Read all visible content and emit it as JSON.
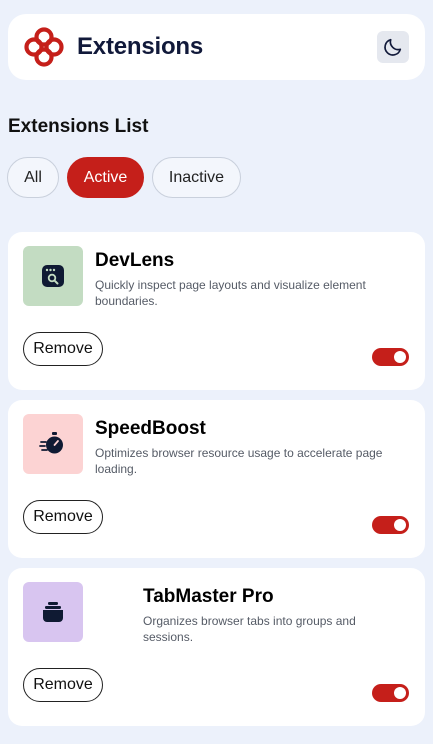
{
  "header": {
    "title": "Extensions",
    "logo_icon": "logo-icon",
    "theme_icon": "moon-icon"
  },
  "section": {
    "title": "Extensions List"
  },
  "filters": [
    {
      "label": "All",
      "selected": false
    },
    {
      "label": "Active",
      "selected": true
    },
    {
      "label": "Inactive",
      "selected": false
    }
  ],
  "extensions": [
    {
      "name": "DevLens",
      "description": "Quickly inspect page layouts and visualize element boundaries.",
      "icon": "devlens-icon",
      "icon_bg": "#c3dcc2",
      "remove_label": "Remove",
      "enabled": true
    },
    {
      "name": "SpeedBoost",
      "description": "Optimizes browser resource usage to accelerate page loading.",
      "icon": "speedboost-icon",
      "icon_bg": "#fcd3d3",
      "remove_label": "Remove",
      "enabled": true
    },
    {
      "name": "TabMaster Pro",
      "description": "Organizes browser tabs into groups and sessions.",
      "icon": "tabmaster-icon",
      "icon_bg": "#d8c5f0",
      "remove_label": "Remove",
      "enabled": true
    }
  ],
  "colors": {
    "accent": "#c51f1a",
    "background": "#ecf1fb",
    "navy": "#11193a"
  }
}
